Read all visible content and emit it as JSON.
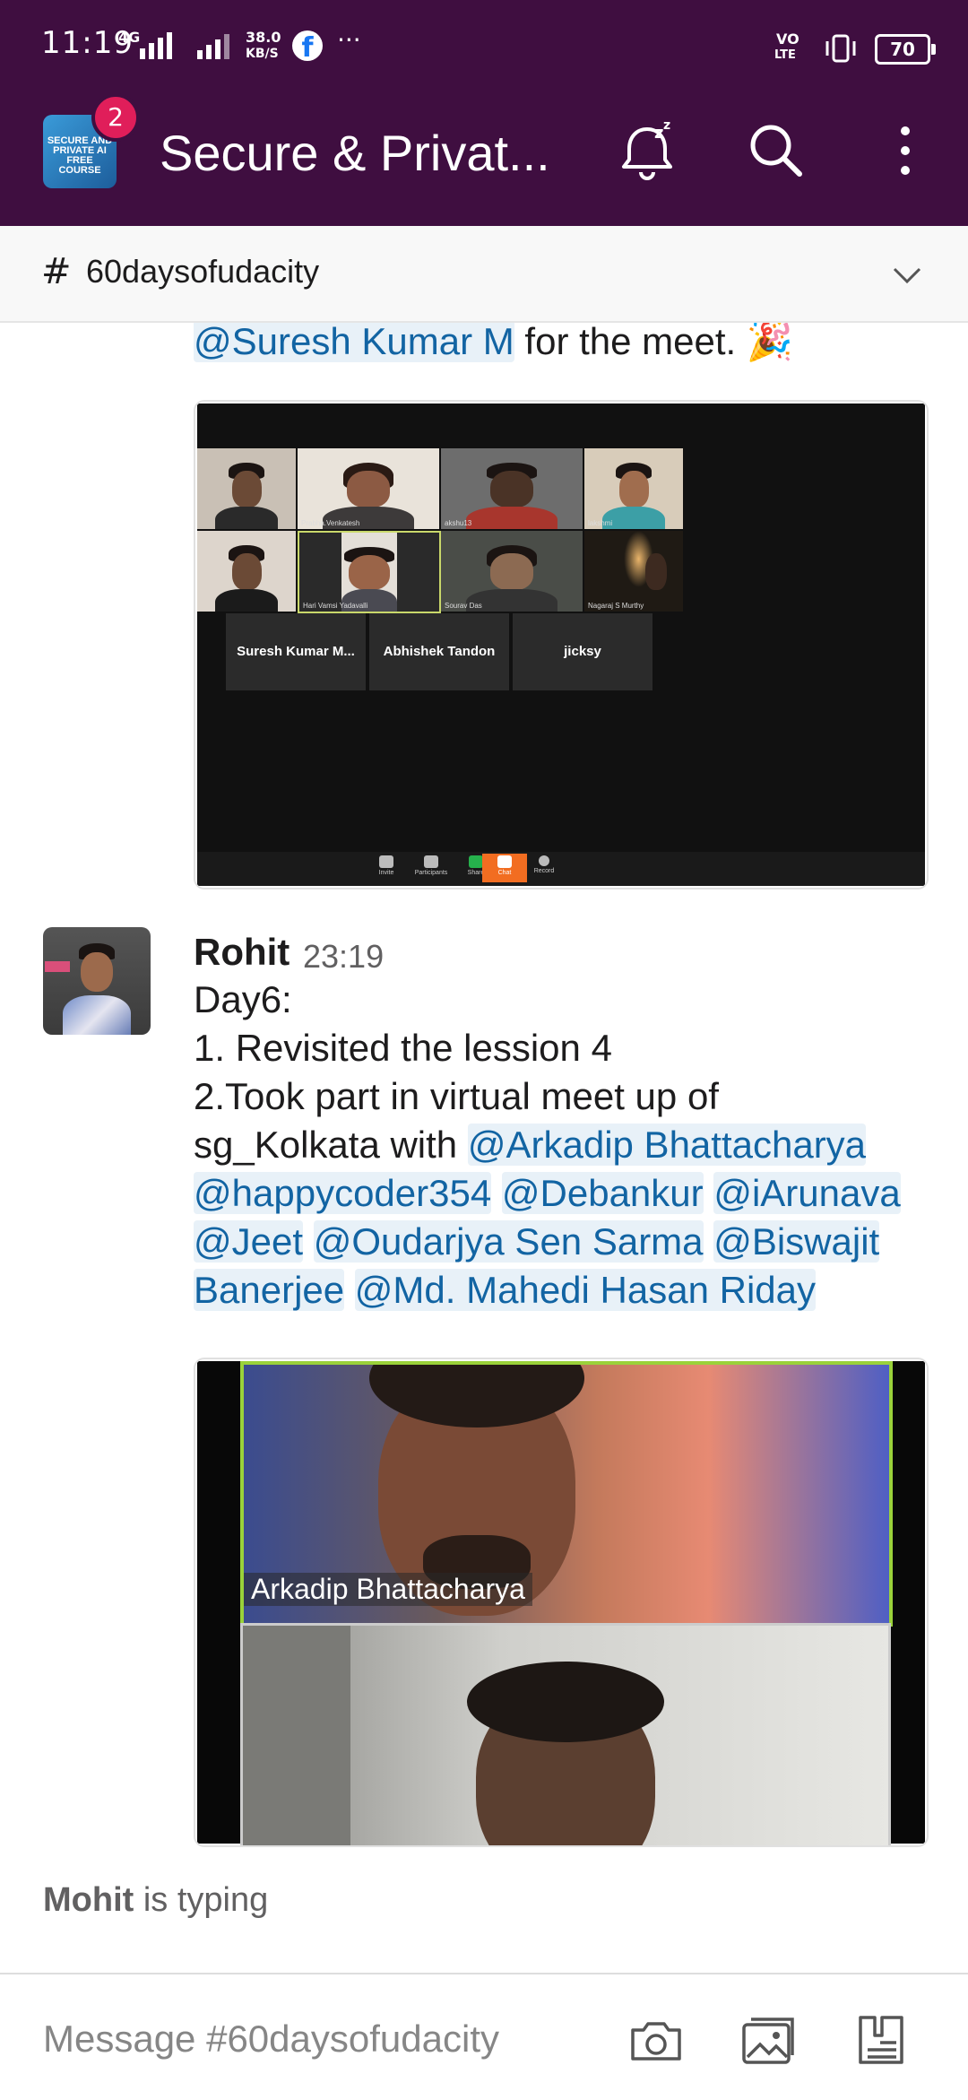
{
  "status_bar": {
    "time": "11:19",
    "net1": "4G",
    "speed_value": "38.0",
    "speed_unit": "KB/S",
    "volte_line1": "VO",
    "volte_line2": "LTE",
    "battery": "70"
  },
  "app_bar": {
    "workspace_logo_text": "SECURE AND PRIVATE AI FREE COURSE",
    "workspace_badge": "2",
    "workspace_title": "Secure & Privat...",
    "icons": [
      "snooze-bell-icon",
      "search-icon",
      "more-vert-icon"
    ]
  },
  "channel": {
    "hash": "#",
    "name": "60daysofudacity"
  },
  "feed": {
    "prev_message": {
      "mention": "@Suresh Kumar M",
      "tail": " for the meet. 🎉"
    },
    "zoom1": {
      "tile_names": [
        "",
        "Prabha.Venkatesh",
        "akshu13",
        "lakshmi",
        "",
        "Hari Vamsi Yadavalli",
        "Sourav Das",
        "Nagaraj S Murthy"
      ],
      "dark_tiles": [
        "Suresh Kumar M...",
        "Abhishek Tandon",
        "jicksy"
      ],
      "toolbar": [
        "Invite",
        "Participants",
        "Share",
        "Chat",
        "Record"
      ]
    },
    "message": {
      "author": "Rohit",
      "time": "23:19",
      "lines": {
        "l1": "Day6:",
        "l2": "1. Revisited the lession 4",
        "l3": "2.Took part in virtual meet up of",
        "l4_text": "sg_Kolkata with ",
        "l4_m1": "@Arkadip Bhattacharya",
        "l5_m1": "@happycoder354",
        "l5_m2": "@Debankur",
        "l5_m3": "@iArunava",
        "l6_m1": "@Jeet",
        "l6_m2": "@Oudarjya Sen Sarma",
        "l6_m3": "@Biswajit",
        "l7_m1": "Banerjee",
        "l7_m2": "@Md. Mahedi Hasan Riday"
      }
    },
    "zoom2": {
      "participant_name": "Arkadip Bhattacharya"
    }
  },
  "typing": {
    "name": "Mohit",
    "text": " is typing"
  },
  "composer": {
    "placeholder": "Message #60daysofudacity",
    "icons": [
      "camera-icon",
      "gallery-icon",
      "files-icon"
    ]
  },
  "colors": {
    "aubergine": "#3f0e40",
    "mention_text": "#1264a3",
    "mention_bg": "#e8f1f8",
    "badge": "#e01e5a"
  }
}
